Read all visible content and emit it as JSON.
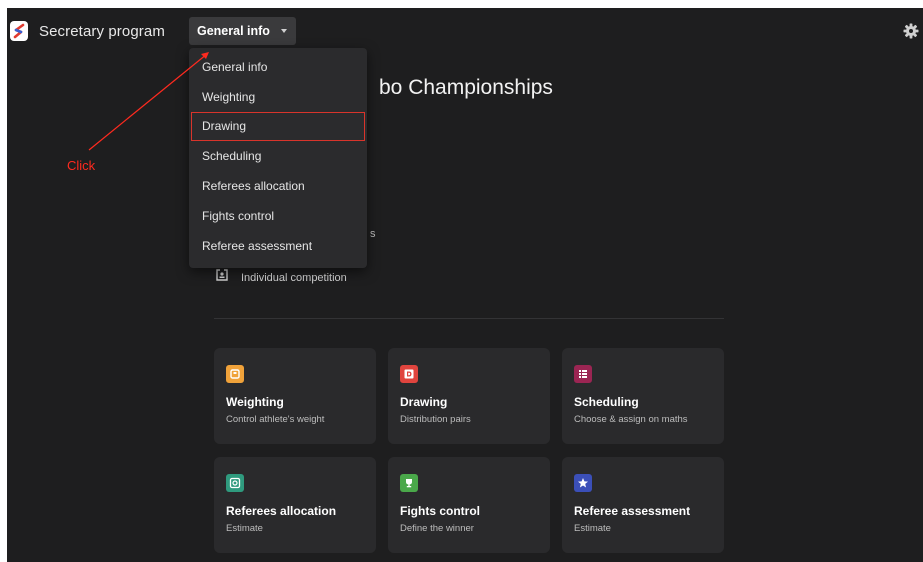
{
  "header": {
    "app_title": "Secretary program",
    "nav_label": "General info"
  },
  "page": {
    "title_visible": "bo Championships",
    "partial_text": "s",
    "competition_type": "Individual competition"
  },
  "menu": {
    "items": [
      {
        "label": "General info"
      },
      {
        "label": "Weighting"
      },
      {
        "label": "Drawing"
      },
      {
        "label": "Scheduling"
      },
      {
        "label": "Referees allocation"
      },
      {
        "label": "Fights control"
      },
      {
        "label": "Referee assessment"
      }
    ],
    "highlighted": "Drawing"
  },
  "annotation": {
    "text": "Click",
    "color": "#ff2a1f"
  },
  "cards": [
    {
      "title": "Weighting",
      "subtitle": "Control athlete's weight",
      "icon": "scale-icon",
      "color": "#f0a23a"
    },
    {
      "title": "Drawing",
      "subtitle": "Distribution pairs",
      "icon": "letter-d-icon",
      "color": "#e0443e"
    },
    {
      "title": "Scheduling",
      "subtitle": "Choose & assign on maths",
      "icon": "schedule-icon",
      "color": "#9b2553"
    },
    {
      "title": "Referees allocation",
      "subtitle": "Estimate",
      "icon": "target-icon",
      "color": "#2f9a7e"
    },
    {
      "title": "Fights control",
      "subtitle": "Define the winner",
      "icon": "trophy-icon",
      "color": "#4aa84a"
    },
    {
      "title": "Referee assessment",
      "subtitle": "Estimate",
      "icon": "star-icon",
      "color": "#3b4fb8"
    }
  ]
}
